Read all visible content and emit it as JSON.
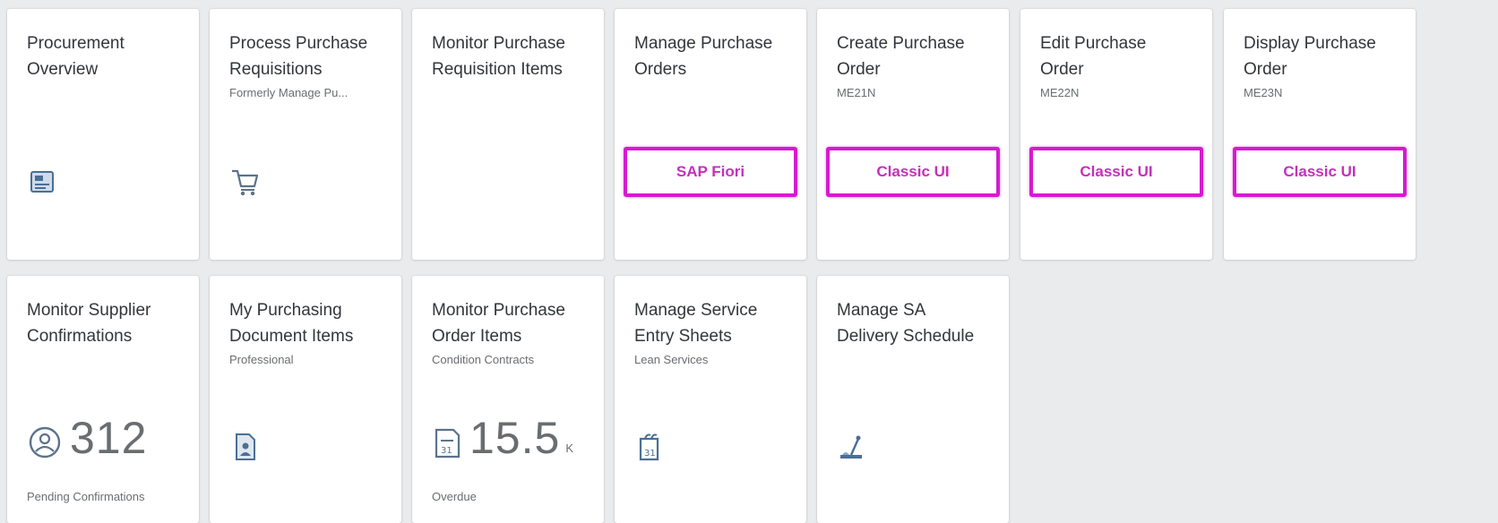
{
  "accent_color": "#d61ad1",
  "tiles_row1": [
    {
      "title": "Procurement Overview",
      "subtitle": "",
      "icon": "overview-icon"
    },
    {
      "title": "Process Purchase Requisitions",
      "subtitle": "Formerly Manage Pu...",
      "icon": "shopping-cart-icon"
    },
    {
      "title": "Monitor Purchase Requisition Items",
      "subtitle": "",
      "icon": ""
    },
    {
      "title": "Manage Purchase Orders",
      "subtitle": "",
      "button": "SAP Fiori"
    },
    {
      "title": "Create Purchase Order",
      "subtitle": "ME21N",
      "button": "Classic UI"
    },
    {
      "title": "Edit Purchase Order",
      "subtitle": "ME22N",
      "button": "Classic UI"
    },
    {
      "title": "Display Purchase Order",
      "subtitle": "ME23N",
      "button": "Classic UI"
    }
  ],
  "tiles_row2": [
    {
      "title": "Monitor Supplier Confirmations",
      "subtitle": "",
      "icon": "person-badge-icon",
      "kpi_value": "312",
      "kpi_unit": "",
      "footer": "Pending Confirmations"
    },
    {
      "title": "My Purchasing Document Items",
      "subtitle": "Professional",
      "icon": "document-person-icon"
    },
    {
      "title": "Monitor Purchase Order Items",
      "subtitle": "Condition Contracts",
      "icon": "calendar-document-icon",
      "kpi_value": "15.5",
      "kpi_unit": "K",
      "footer": "Overdue"
    },
    {
      "title": "Manage Service Entry Sheets",
      "subtitle": "Lean Services",
      "icon": "service-sheet-icon"
    },
    {
      "title": "Manage SA Delivery Schedule",
      "subtitle": "",
      "icon": "delivery-schedule-icon"
    }
  ]
}
